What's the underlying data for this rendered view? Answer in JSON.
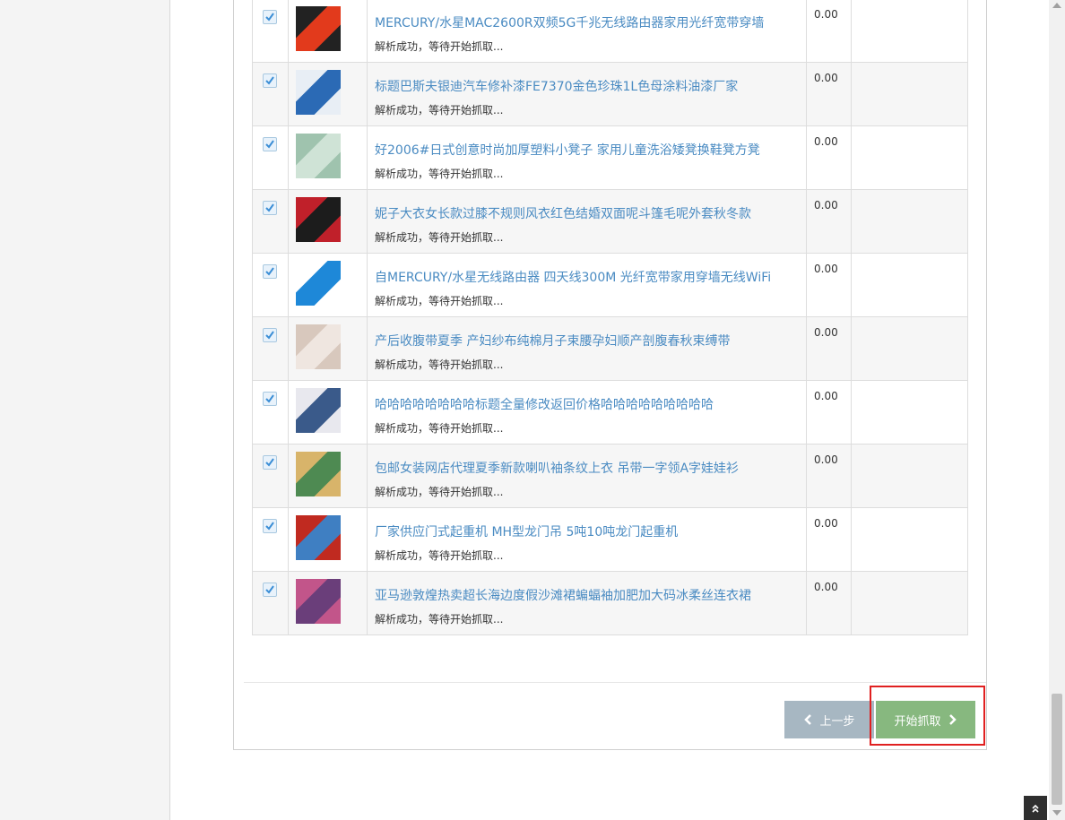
{
  "rows": [
    {
      "title": "MERCURY/水星MAC2600R双频5G千兆无线路由器家用光纤宽带穿墙",
      "status": "解析成功，等待开始抓取...",
      "price": "0.00",
      "checked": true,
      "thumb_icon": "router-image",
      "thumb_colors": [
        "#e23a1c",
        "#222222"
      ]
    },
    {
      "title": "标题巴斯夫银迪汽车修补漆FE7370金色珍珠1L色母涂料油漆厂家",
      "status": "解析成功，等待开始抓取...",
      "price": "0.00",
      "checked": true,
      "thumb_icon": "paint-can-image",
      "thumb_colors": [
        "#2b6ab5",
        "#e8eef5"
      ]
    },
    {
      "title": "好2006#日式创意时尚加厚塑料小凳子 家用儿童洗浴矮凳换鞋凳方凳",
      "status": "解析成功，等待开始抓取...",
      "price": "0.00",
      "checked": true,
      "thumb_icon": "stool-image",
      "thumb_colors": [
        "#cfe3d6",
        "#9fc3ae"
      ]
    },
    {
      "title": "妮子大衣女长款过膝不规则风衣红色结婚双面呢斗篷毛呢外套秋冬款",
      "status": "解析成功，等待开始抓取...",
      "price": "0.00",
      "checked": true,
      "thumb_icon": "coat-image",
      "thumb_colors": [
        "#1c1c1c",
        "#c0202a"
      ]
    },
    {
      "title": "自MERCURY/水星无线路由器 四天线300M 光纤宽带家用穿墙无线WiFi",
      "status": "解析成功，等待开始抓取...",
      "price": "0.00",
      "checked": true,
      "thumb_icon": "router-image",
      "thumb_colors": [
        "#1e88d8",
        "#ffffff"
      ]
    },
    {
      "title": "产后收腹带夏季 产妇纱布纯棉月子束腰孕妇顺产剖腹春秋束缚带",
      "status": "解析成功，等待开始抓取...",
      "price": "0.00",
      "checked": true,
      "thumb_icon": "belly-band-image",
      "thumb_colors": [
        "#efe6e0",
        "#d8c8bd"
      ]
    },
    {
      "title": "哈哈哈哈哈哈哈哈标题全量修改返回价格哈哈哈哈哈哈哈哈哈",
      "status": "解析成功，等待开始抓取...",
      "price": "0.00",
      "checked": true,
      "thumb_icon": "dress-image",
      "thumb_colors": [
        "#3a5a8a",
        "#e8e8ee"
      ]
    },
    {
      "title": "包邮女装网店代理夏季新款喇叭袖条纹上衣 吊带一字领A字娃娃衫",
      "status": "解析成功，等待开始抓取...",
      "price": "0.00",
      "checked": true,
      "thumb_icon": "blouse-image",
      "thumb_colors": [
        "#4e8a52",
        "#d8b46a"
      ]
    },
    {
      "title": "厂家供应门式起重机 MH型龙门吊 5吨10吨龙门起重机",
      "status": "解析成功，等待开始抓取...",
      "price": "0.00",
      "checked": true,
      "thumb_icon": "crane-image",
      "thumb_colors": [
        "#3f7fc2",
        "#c02a20"
      ]
    },
    {
      "title": "亚马逊敦煌热卖超长海边度假沙滩裙蝙蝠袖加肥加大码冰柔丝连衣裙",
      "status": "解析成功，等待开始抓取...",
      "price": "0.00",
      "checked": true,
      "thumb_icon": "long-dress-image",
      "thumb_colors": [
        "#6a3e7a",
        "#c2558a"
      ]
    }
  ],
  "buttons": {
    "prev_label": "上一步",
    "start_label": "开始抓取"
  },
  "colors": {
    "link": "#4a8bc2",
    "prev_button": "#a7b7c2",
    "start_button": "#87b87f",
    "highlight": "#e02020"
  }
}
